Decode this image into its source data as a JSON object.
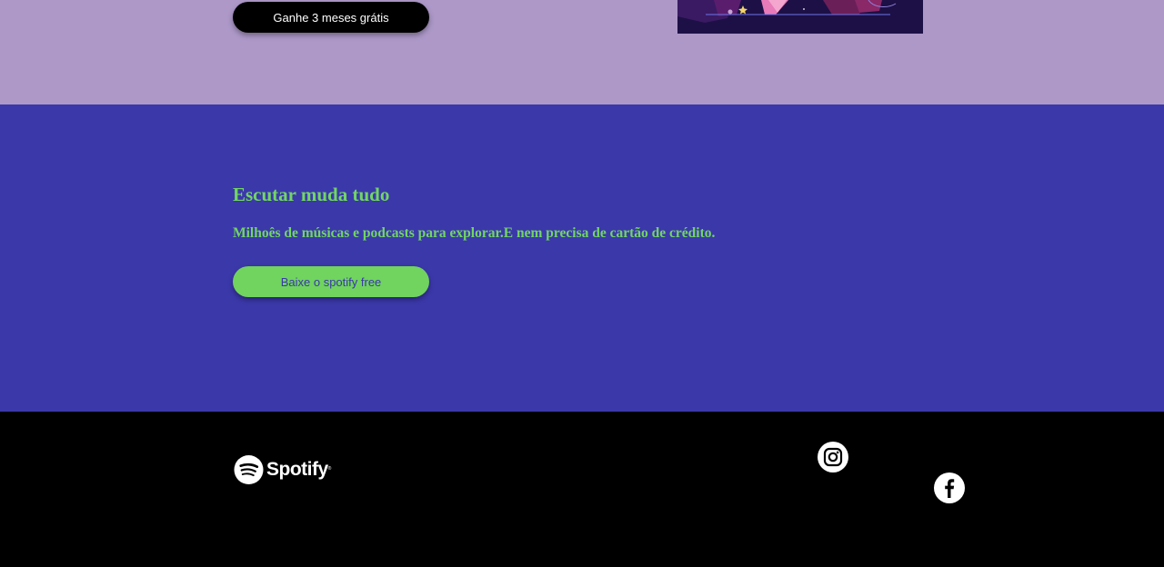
{
  "promo": {
    "cta_label": "Ganhe 3 meses grátis",
    "image_icon": "illustration-image"
  },
  "download": {
    "headline": "Escutar muda tudo",
    "subline": "Milhoês de músicas e podcasts para explorar.E nem precisa de cartão de crédito.",
    "cta_label": "Baixe o spotify free"
  },
  "footer": {
    "logo_text": "Spotify",
    "logo_mark": "®",
    "social": [
      {
        "name": "Instagram",
        "icon": "instagram-icon"
      },
      {
        "name": "Facebook",
        "icon": "facebook-icon"
      }
    ]
  },
  "colors": {
    "lilac": "#ad98c8",
    "blue": "#3b38aa",
    "green": "#71d662",
    "black": "#000000",
    "white": "#ffffff"
  }
}
